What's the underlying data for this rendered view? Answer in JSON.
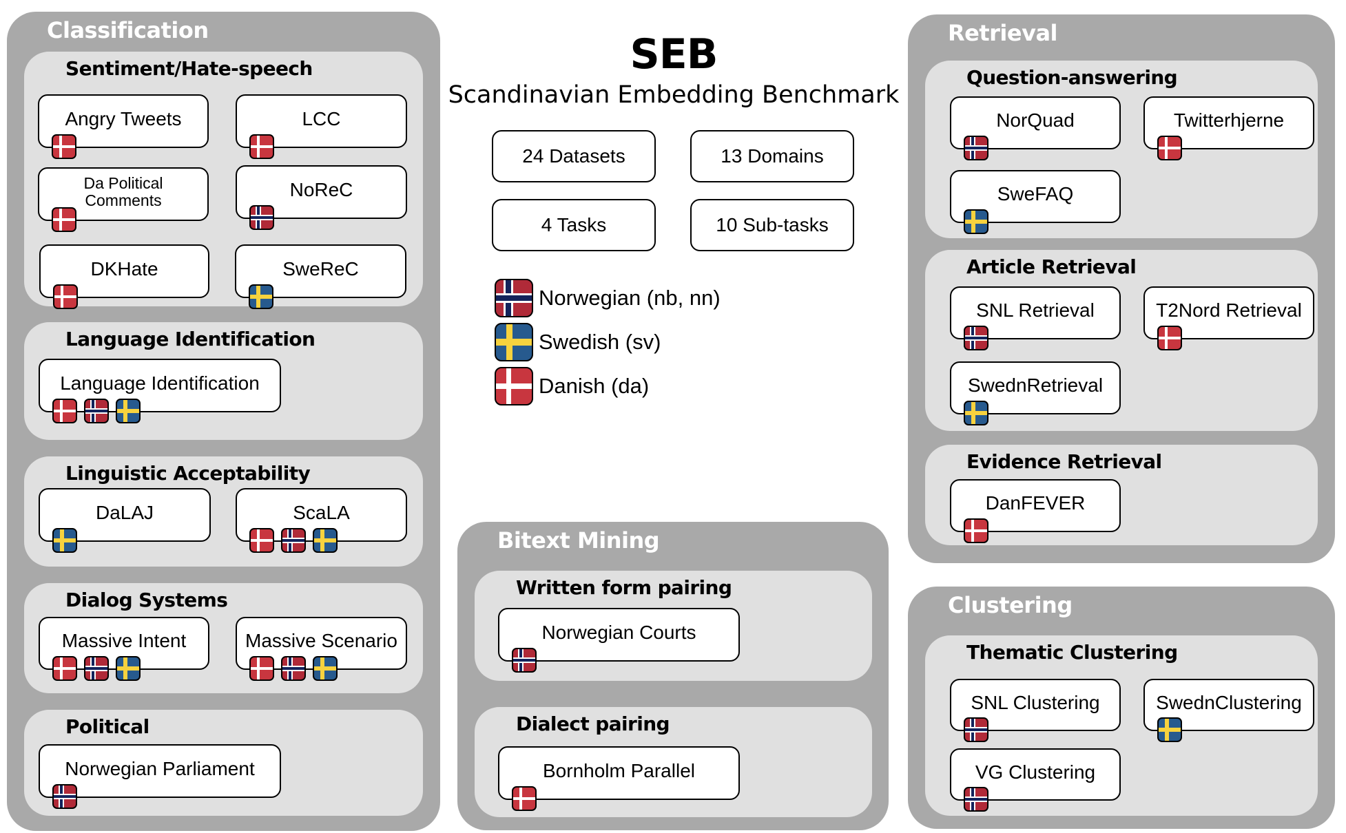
{
  "header": {
    "title": "SEB",
    "subtitle": "Scandinavian Embedding Benchmark"
  },
  "stats": [
    {
      "label": "24 Datasets"
    },
    {
      "label": "13 Domains"
    },
    {
      "label": "4 Tasks"
    },
    {
      "label": "10 Sub-tasks"
    }
  ],
  "legend": [
    {
      "flag": "no",
      "icon": "norway-flag-icon",
      "label": "Norwegian (nb, nn)"
    },
    {
      "flag": "se",
      "icon": "sweden-flag-icon",
      "label": "Swedish (sv)"
    },
    {
      "flag": "dk",
      "icon": "denmark-flag-icon",
      "label": "Danish (da)"
    }
  ],
  "colors": {
    "panel_bg": "#a9a9a9",
    "subgroup_bg": "#e0e0e0",
    "denmark_red": "#c8363f",
    "norway_red": "#b02a38",
    "norway_blue": "#13235b",
    "sweden_blue": "#275a8e",
    "sweden_yellow": "#f7d23e"
  },
  "tasks": {
    "classification": {
      "title": "Classification",
      "subgroups": [
        {
          "title": "Sentiment/Hate-speech",
          "datasets": [
            {
              "name": "Angry Tweets",
              "langs": [
                "dk"
              ]
            },
            {
              "name": "LCC",
              "langs": [
                "dk"
              ]
            },
            {
              "name": "Da Political Comments",
              "langs": [
                "dk"
              ]
            },
            {
              "name": "NoReC",
              "langs": [
                "no"
              ]
            },
            {
              "name": "DKHate",
              "langs": [
                "dk"
              ]
            },
            {
              "name": "SweReC",
              "langs": [
                "se"
              ]
            }
          ]
        },
        {
          "title": "Language Identification",
          "datasets": [
            {
              "name": "Language Identification",
              "langs": [
                "dk",
                "no",
                "se"
              ]
            }
          ]
        },
        {
          "title": "Linguistic Acceptability",
          "datasets": [
            {
              "name": "DaLAJ",
              "langs": [
                "se"
              ]
            },
            {
              "name": "ScaLA",
              "langs": [
                "dk",
                "no",
                "se"
              ]
            }
          ]
        },
        {
          "title": "Dialog Systems",
          "datasets": [
            {
              "name": "Massive Intent",
              "langs": [
                "dk",
                "no",
                "se"
              ]
            },
            {
              "name": "Massive Scenario",
              "langs": [
                "dk",
                "no",
                "se"
              ]
            }
          ]
        },
        {
          "title": "Political",
          "datasets": [
            {
              "name": "Norwegian Parliament",
              "langs": [
                "no"
              ]
            }
          ]
        }
      ]
    },
    "bitext": {
      "title": "Bitext Mining",
      "subgroups": [
        {
          "title": "Written form pairing",
          "datasets": [
            {
              "name": "Norwegian Courts",
              "langs": [
                "no"
              ]
            }
          ]
        },
        {
          "title": "Dialect pairing",
          "datasets": [
            {
              "name": "Bornholm Parallel",
              "langs": [
                "dk"
              ]
            }
          ]
        }
      ]
    },
    "retrieval": {
      "title": "Retrieval",
      "subgroups": [
        {
          "title": "Question-answering",
          "datasets": [
            {
              "name": "NorQuad",
              "langs": [
                "no"
              ]
            },
            {
              "name": "Twitterhjerne",
              "langs": [
                "dk"
              ]
            },
            {
              "name": "SweFAQ",
              "langs": [
                "se"
              ]
            }
          ]
        },
        {
          "title": "Article Retrieval",
          "datasets": [
            {
              "name": "SNL Retrieval",
              "langs": [
                "no"
              ]
            },
            {
              "name": "T2Nord Retrieval",
              "langs": [
                "dk"
              ]
            },
            {
              "name": "SwednRetrieval",
              "langs": [
                "se"
              ]
            }
          ]
        },
        {
          "title": "Evidence Retrieval",
          "datasets": [
            {
              "name": "DanFEVER",
              "langs": [
                "dk"
              ]
            }
          ]
        }
      ]
    },
    "clustering": {
      "title": "Clustering",
      "subgroups": [
        {
          "title": "Thematic Clustering",
          "datasets": [
            {
              "name": "SNL Clustering",
              "langs": [
                "no"
              ]
            },
            {
              "name": "SwednClustering",
              "langs": [
                "se"
              ]
            },
            {
              "name": "VG Clustering",
              "langs": [
                "no"
              ]
            }
          ]
        }
      ]
    }
  }
}
